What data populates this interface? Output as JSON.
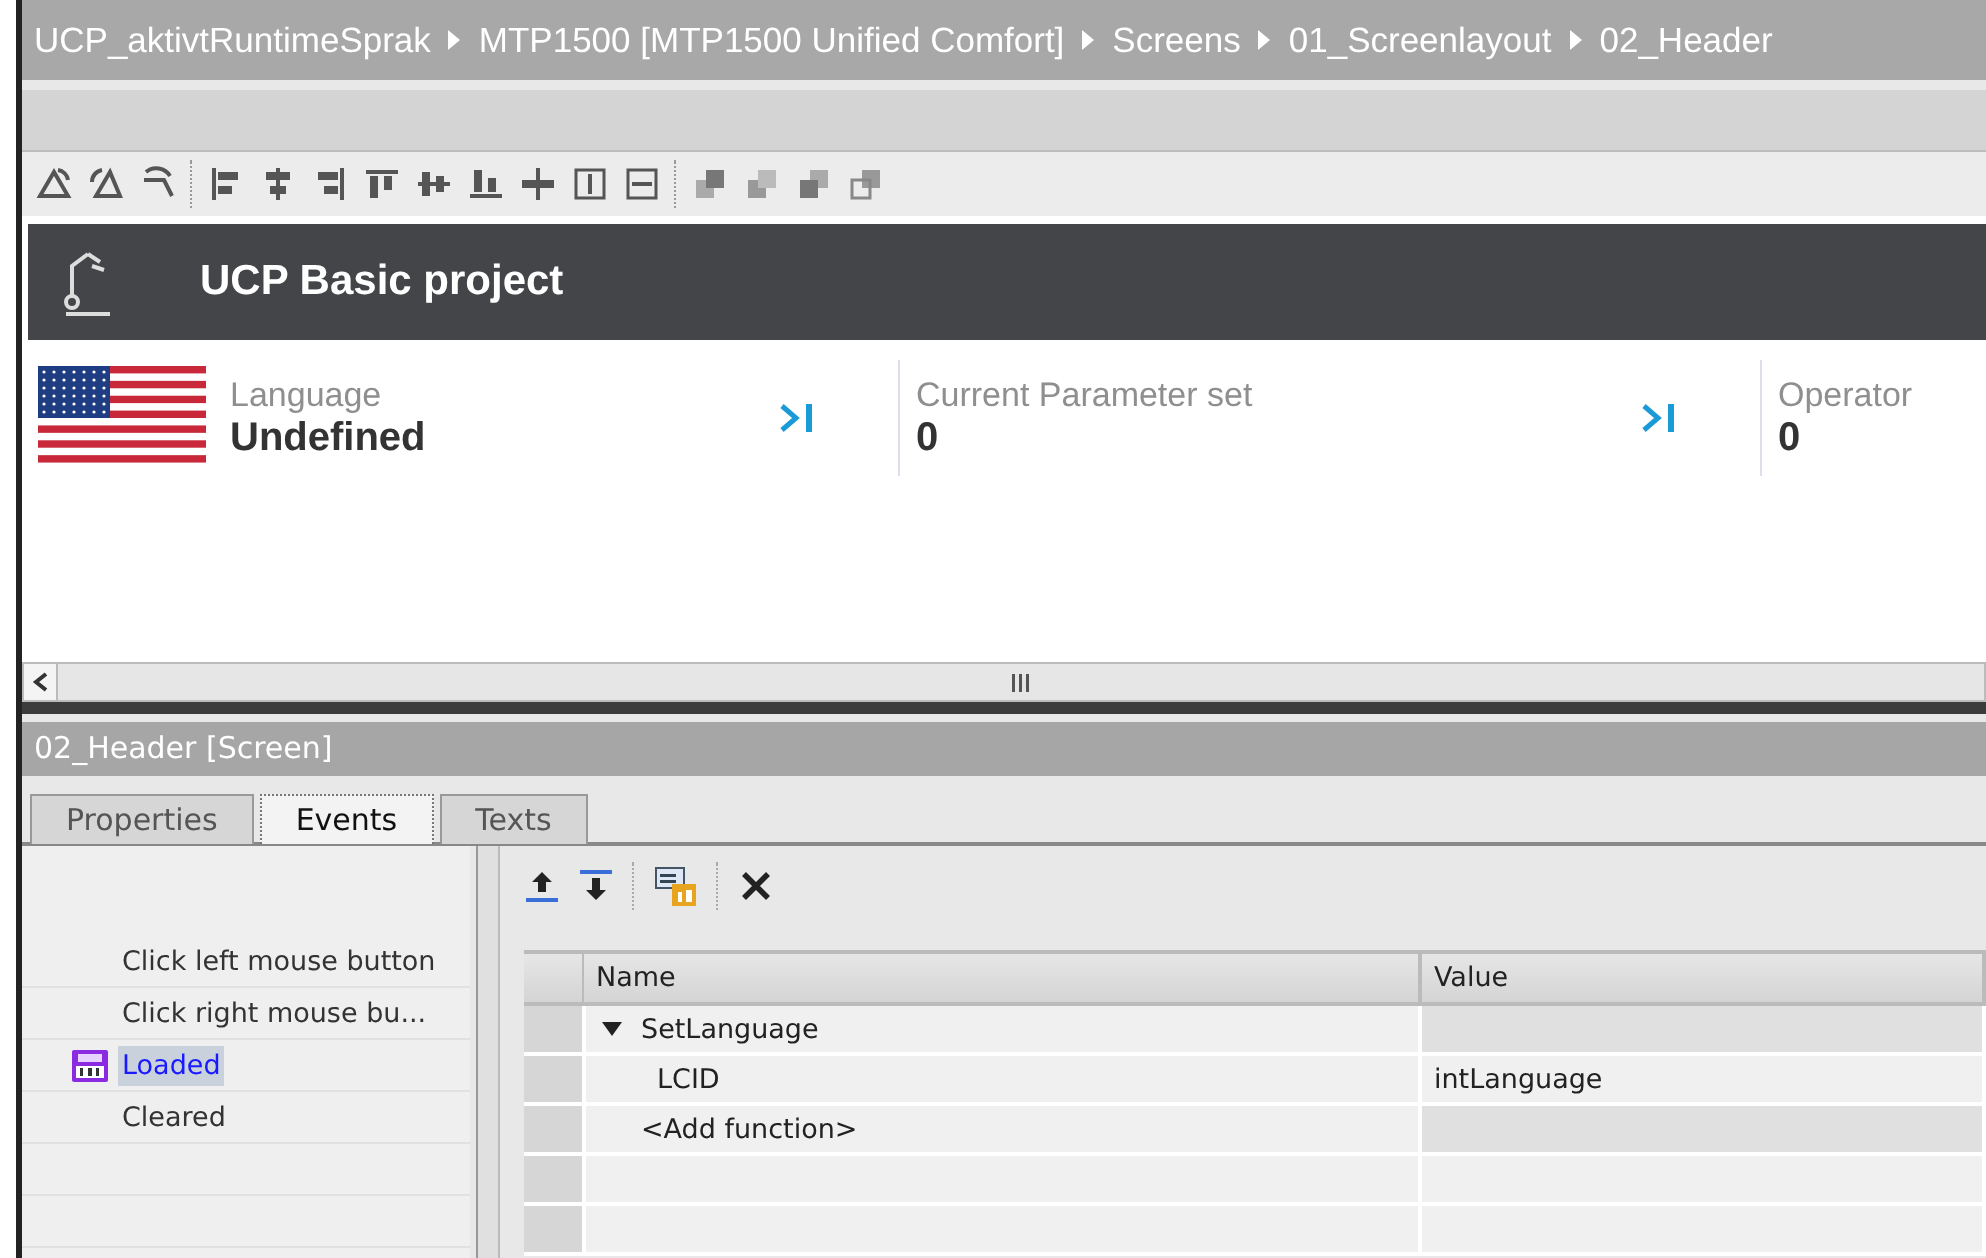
{
  "breadcrumb": [
    "UCP_aktivtRuntimeSprak",
    "MTP1500 [MTP1500 Unified Comfort]",
    "Screens",
    "01_Screenlayout",
    "02_Header"
  ],
  "screen": {
    "title": "UCP Basic project",
    "fields": [
      {
        "kind": "flag",
        "label": "Language",
        "value": "Undefined"
      },
      {
        "kind": "select",
        "label": "Current Parameter set",
        "value": "0"
      },
      {
        "kind": "plain",
        "label": "Operator",
        "value": "0"
      }
    ]
  },
  "inspector": {
    "title": "02_Header [Screen]",
    "tabs": [
      {
        "label": "Properties",
        "selected": false
      },
      {
        "label": "Events",
        "selected": true
      },
      {
        "label": "Texts",
        "selected": false
      }
    ],
    "events": [
      {
        "label": "Click left mouse button",
        "selected": false,
        "assigned": false
      },
      {
        "label": "Click right mouse bu...",
        "selected": false,
        "assigned": false
      },
      {
        "label": "Loaded",
        "selected": true,
        "assigned": true
      },
      {
        "label": "Cleared",
        "selected": false,
        "assigned": false
      }
    ],
    "columns": [
      "Name",
      "Value"
    ],
    "rows": [
      {
        "name": "SetLanguage",
        "expanded": true,
        "children": [
          {
            "name": "LCID",
            "value": "intLanguage"
          }
        ]
      },
      {
        "name": "<Add function>"
      }
    ]
  }
}
